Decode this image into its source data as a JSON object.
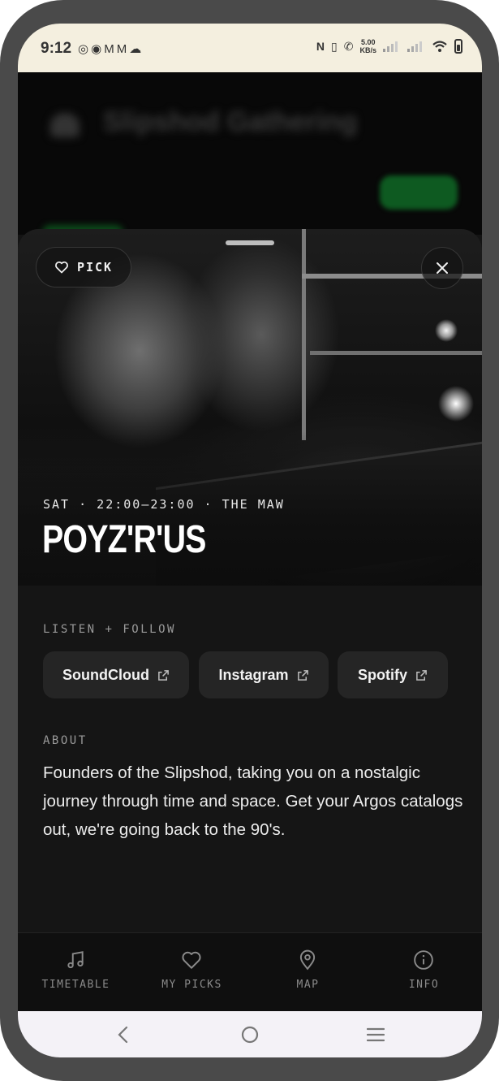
{
  "status_bar": {
    "time": "9:12",
    "left_icons": [
      "whatsapp-icon",
      "messenger-icon",
      "gmail-icon",
      "gmail-icon",
      "soundcloud-icon"
    ],
    "speed_value": "5.00",
    "speed_unit": "KB/s",
    "right_icons": [
      "nfc-icon",
      "vibrate-icon",
      "wifi-call-icon",
      "signal-icon",
      "signal-icon",
      "wifi-icon",
      "battery-icon"
    ]
  },
  "background_app": {
    "title": "Slipshod Gathering"
  },
  "hero": {
    "pick_label": "PICK",
    "meta": "SAT · 22:00–23:00 · THE MAW",
    "artist": "POYZ'R'US"
  },
  "links": {
    "heading": "LISTEN + FOLLOW",
    "items": [
      {
        "label": "SoundCloud"
      },
      {
        "label": "Instagram"
      },
      {
        "label": "Spotify"
      }
    ]
  },
  "about": {
    "heading": "ABOUT",
    "text": "Founders of the Slipshod, taking you on a nostalgic journey through time and space. Get your Argos catalogs out, we're going back to the 90's."
  },
  "nav": {
    "items": [
      {
        "label": "TIMETABLE",
        "icon": "music-note-icon"
      },
      {
        "label": "MY PICKS",
        "icon": "heart-icon"
      },
      {
        "label": "MAP",
        "icon": "map-pin-icon"
      },
      {
        "label": "INFO",
        "icon": "info-icon"
      }
    ]
  },
  "colors": {
    "sheet_background": "#151515",
    "button_background": "#252525",
    "accent_green": "#0e5a21",
    "status_bar": "#f4efdf"
  }
}
